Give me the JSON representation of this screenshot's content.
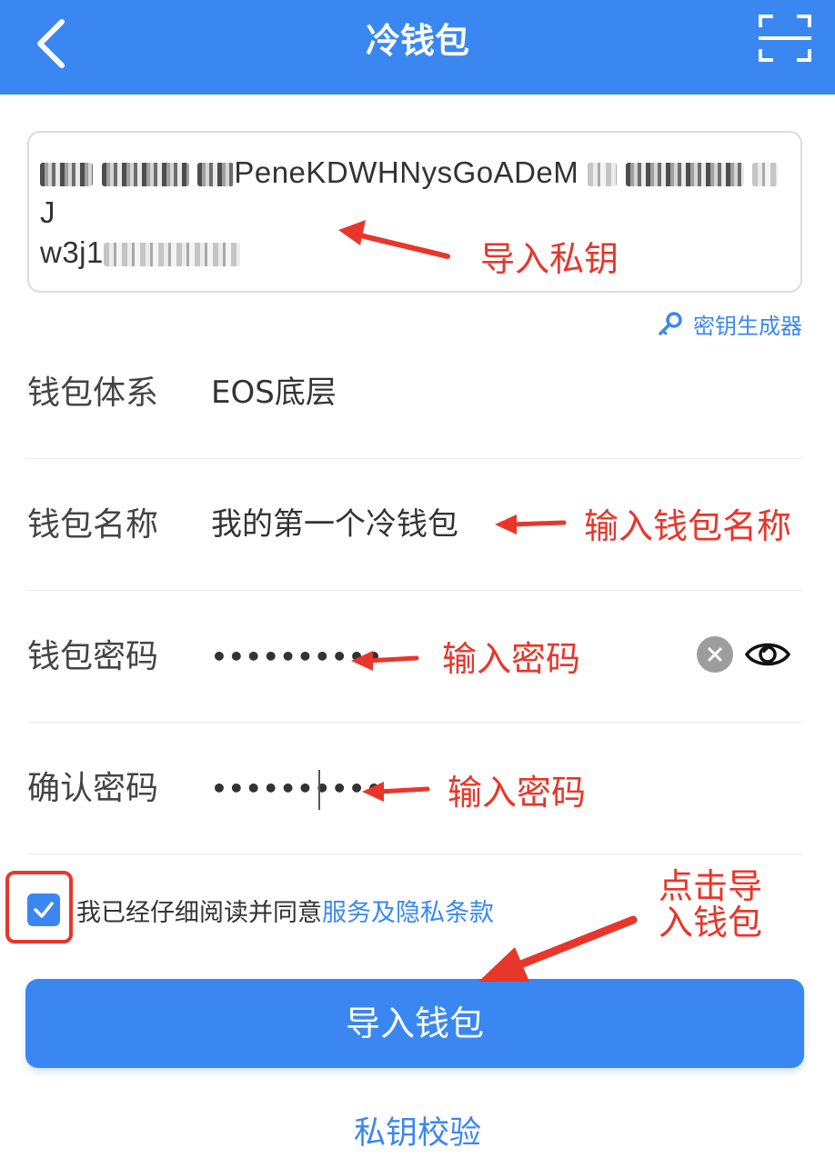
{
  "header": {
    "title": "冷钱包",
    "back_icon": "chevron-left-icon",
    "scan_icon": "scan-icon"
  },
  "private_key": {
    "line1_visible": "PeneKDWHNysGoADeM",
    "line1_tail": "J",
    "line2_visible": "w3j1"
  },
  "key_generator": {
    "label": "密钥生成器",
    "icon": "key-icon"
  },
  "form": {
    "wallet_system": {
      "label": "钱包体系",
      "value": "EOS底层"
    },
    "wallet_name": {
      "label": "钱包名称",
      "value": "我的第一个冷钱包"
    },
    "wallet_password": {
      "label": "钱包密码",
      "value": "••••••••••"
    },
    "confirm_password": {
      "label": "确认密码",
      "value": "••••••••••"
    }
  },
  "agreement": {
    "checked": true,
    "text": "我已经仔细阅读并同意",
    "link": "服务及隐私条款"
  },
  "import_button": {
    "label": "导入钱包"
  },
  "verify_link": {
    "label": "私钥校验"
  },
  "annotations": {
    "import_key": "导入私钥",
    "enter_name": "输入钱包名称",
    "enter_password_1": "输入密码",
    "enter_password_2": "输入密码",
    "click_import_line1": "点击导",
    "click_import_line2": "入钱包"
  },
  "colors": {
    "brand_blue": "#3a87f2",
    "annotation_red": "#e8362b"
  }
}
